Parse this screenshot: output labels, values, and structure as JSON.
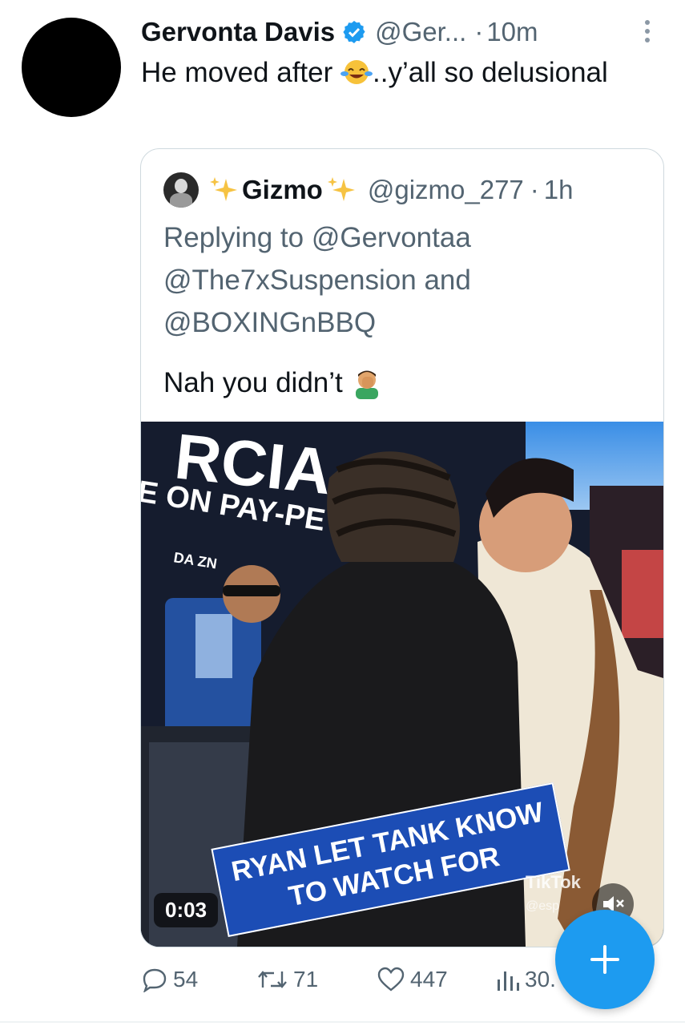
{
  "tweet": {
    "author_name": "Gervonta Davis",
    "author_handle": "@Ger...",
    "dot": "·",
    "time": "10m",
    "text_before_emoji": "He moved after ",
    "text_after_emoji": "..y’all so delusional"
  },
  "quoted_tweet": {
    "author_name": "Gizmo",
    "author_handle": "@gizmo_277",
    "dot": "·",
    "time": "1h",
    "replying_to": "Replying to @Gervontaa @The7xSuspension and @BOXINGnBBQ",
    "text": "Nah you didn’t",
    "video": {
      "caption_line1": "RYAN LET TANK KNOW",
      "caption_line2": "TO WATCH FOR",
      "timer": "0:03",
      "bg_text_1": "RCIA",
      "bg_text_2": "E ON PAY-PE",
      "bg_logo": "DA ZN",
      "watermark": "TikTok",
      "watermark_handle": "@esp"
    }
  },
  "actions": {
    "replies": "54",
    "retweets": "71",
    "likes": "447",
    "views": "30."
  },
  "icons": {
    "verified": "verified-badge-icon",
    "more": "more-vertical-icon",
    "reply": "reply-icon",
    "retweet": "retweet-icon",
    "like": "heart-icon",
    "views": "views-icon",
    "compose": "plus-icon"
  },
  "colors": {
    "accent": "#1d9bf0",
    "text_primary": "#0f1419",
    "text_secondary": "#536471",
    "caption_blue": "#1c4db5"
  }
}
